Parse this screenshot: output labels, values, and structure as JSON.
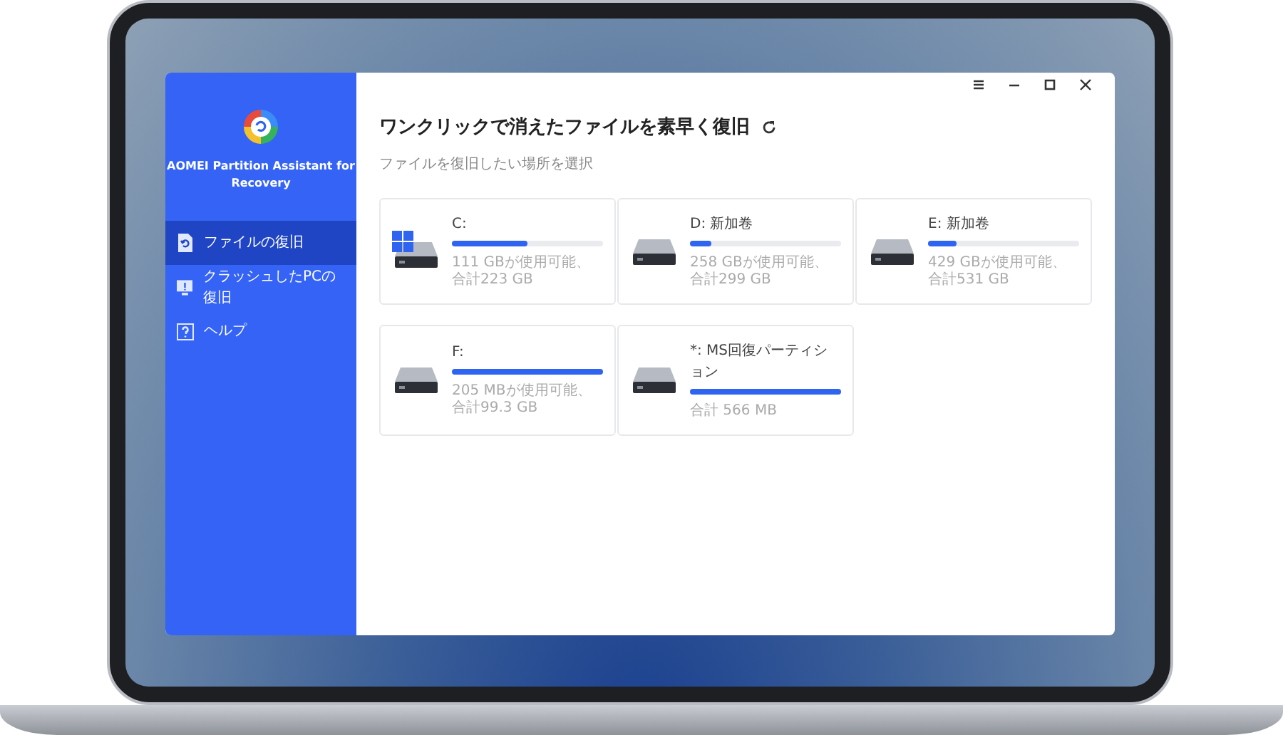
{
  "app": {
    "name": "AOMEI Partition Assistant for Recovery"
  },
  "sidebar": {
    "items": [
      {
        "label": "ファイルの復旧",
        "kind": "file",
        "selected": true
      },
      {
        "label": "クラッシュしたPCの復旧",
        "kind": "monitor",
        "selected": false
      },
      {
        "label": "ヘルプ",
        "kind": "help",
        "selected": false
      }
    ]
  },
  "main": {
    "title": "ワンクリックで消えたファイルを素早く復旧",
    "subtitle": "ファイルを復旧したい場所を選択",
    "drives": [
      {
        "kind": "system",
        "name": "C:",
        "level": 0.5,
        "usage": "111 GBが使用可能、合計223 GB"
      },
      {
        "kind": "disk",
        "name": "D: 新加卷",
        "level": 0.14,
        "usage": "258 GBが使用可能、合計299 GB"
      },
      {
        "kind": "disk",
        "name": "E: 新加卷",
        "level": 0.19,
        "usage": "429 GBが使用可能、合計531 GB"
      },
      {
        "kind": "disk",
        "name": "F:",
        "level": 1.0,
        "usage": "205 MBが使用可能、合計99.3 GB"
      },
      {
        "kind": "disk",
        "name": "*: MS回復パーティション",
        "level": 1.0,
        "usage": "合計 566 MB"
      }
    ]
  }
}
